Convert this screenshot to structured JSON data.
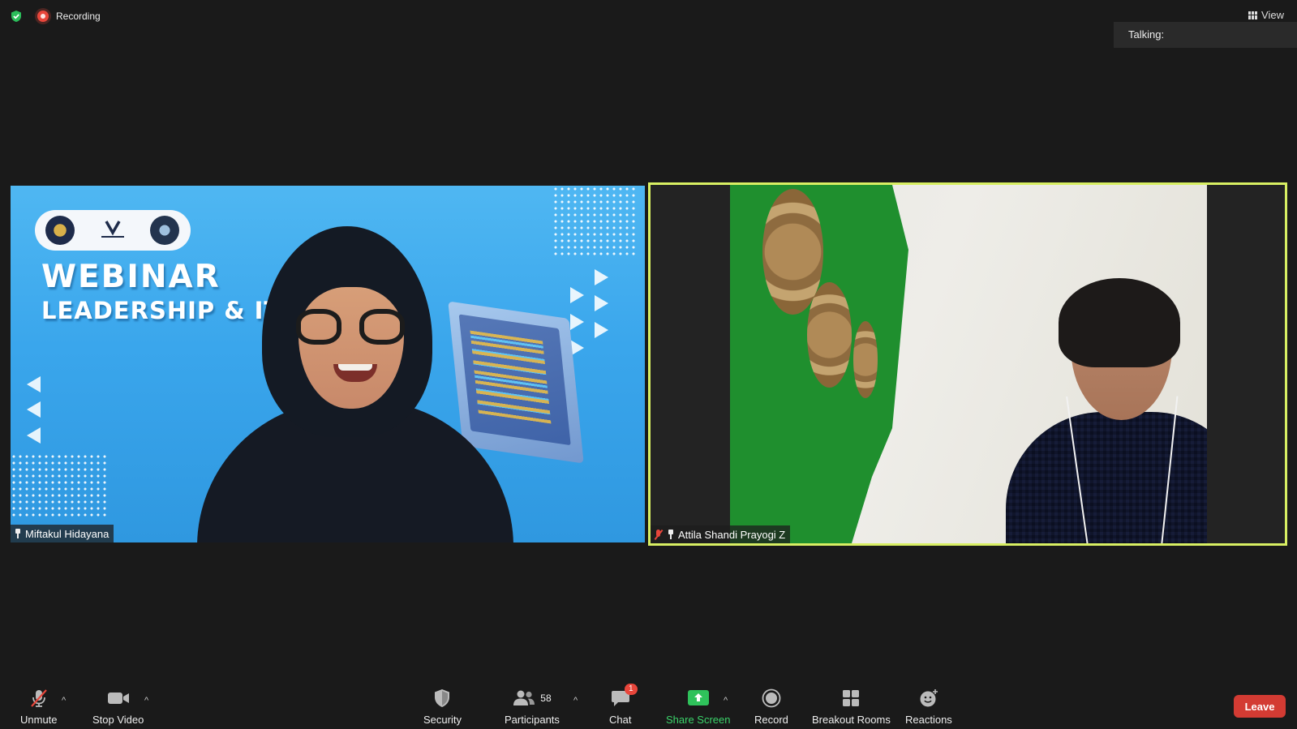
{
  "top_bar": {
    "recording_label": "Recording",
    "view_label": "View"
  },
  "talking_panel": {
    "label": "Talking:"
  },
  "participants": [
    {
      "name": "Miftakul Hidayana",
      "background_title": "WEBINAR",
      "background_subtitle": "LEADERSHIP & IT"
    },
    {
      "name": "Attila Shandi Prayogi Z",
      "muted": true,
      "active_speaker": true
    }
  ],
  "toolbar": {
    "unmute_label": "Unmute",
    "stop_video_label": "Stop Video",
    "security_label": "Security",
    "participants_label": "Participants",
    "participants_count": "58",
    "chat_label": "Chat",
    "chat_badge": "1",
    "share_screen_label": "Share Screen",
    "record_label": "Record",
    "breakout_rooms_label": "Breakout Rooms",
    "reactions_label": "Reactions",
    "leave_label": "Leave"
  },
  "colors": {
    "background": "#1a1a1a",
    "active_speaker_border": "#d8ef63",
    "recording_red": "#e8463b",
    "share_green": "#3bd36a",
    "leave_red": "#d33b33",
    "encryption_green": "#2bbd5a"
  }
}
